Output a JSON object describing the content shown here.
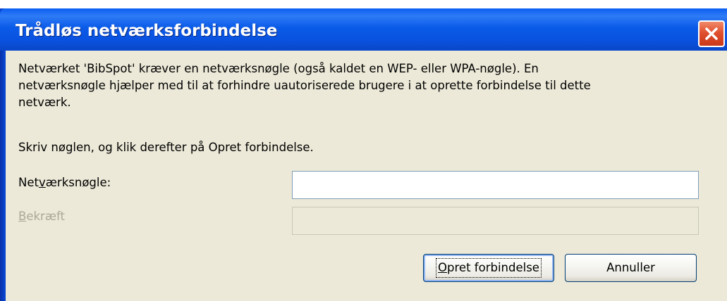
{
  "window": {
    "title": "Trådløs netværksforbindelse",
    "close_icon": "close-icon",
    "accent_color": "#0a52e0",
    "close_color": "#e0502e"
  },
  "message": {
    "line1": "Netværket 'BibSpot' kræver en netværksnøgle (også kaldet en WEP- eller WPA-nøgle). En",
    "line2": "netværksnøgle hjælper med til at forhindre uautoriserede brugere i at oprette forbindelse til dette",
    "line3": "netværk.",
    "instruction": "Skriv nøglen, og klik derefter på Opret forbindelse."
  },
  "fields": {
    "key_label_pre": "Net",
    "key_label_access": "v",
    "key_label_post": "ærksnøgle:",
    "key_value": "",
    "confirm_label_access": "B",
    "confirm_label_post": "ekræft",
    "confirm_value": ""
  },
  "buttons": {
    "connect_access": "O",
    "connect_post": "pret forbindelse",
    "cancel": "Annuller"
  }
}
